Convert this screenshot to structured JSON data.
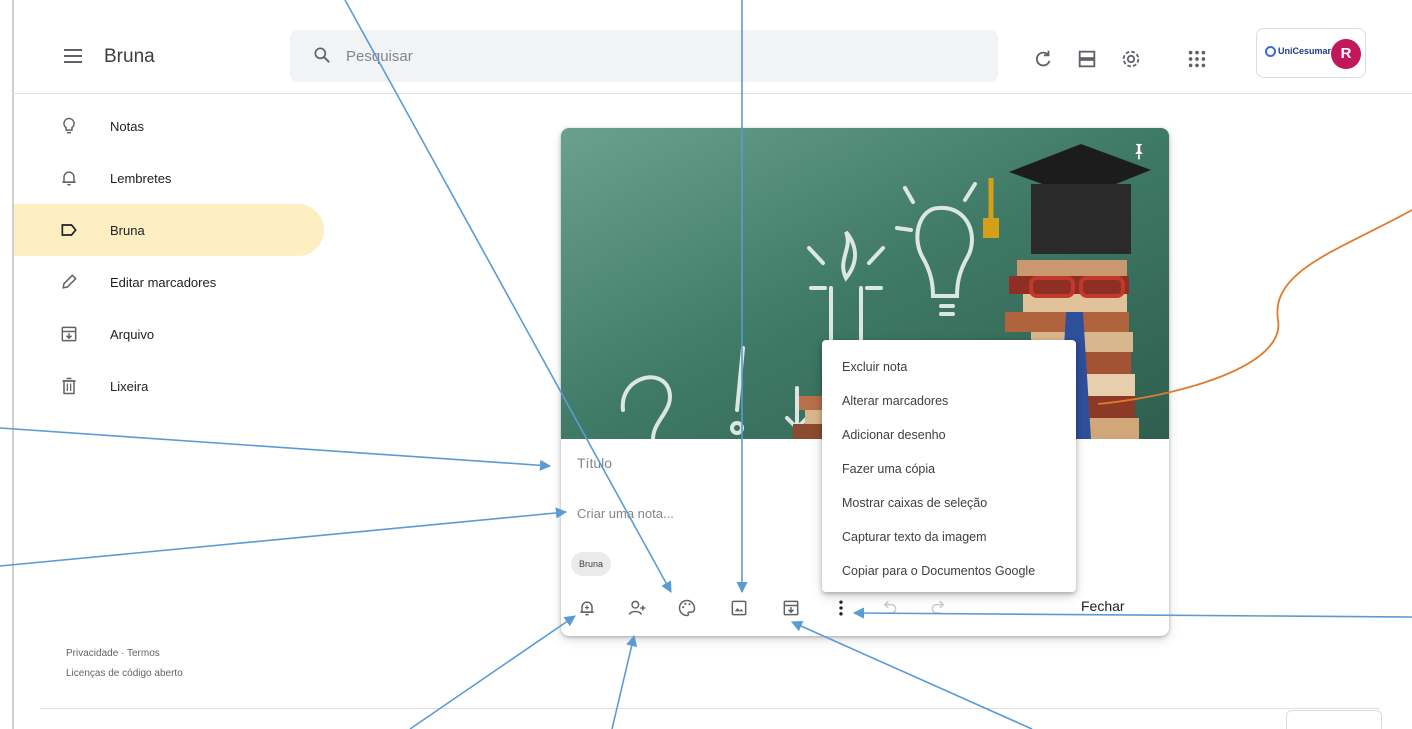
{
  "header": {
    "app_title": "Bruna",
    "search_placeholder": "Pesquisar",
    "org_logo_text": "UniCesumar",
    "avatar_initial": "R"
  },
  "sidebar": {
    "items": [
      {
        "label": "Notas",
        "icon": "lightbulb-icon"
      },
      {
        "label": "Lembretes",
        "icon": "bell-icon"
      },
      {
        "label": "Bruna",
        "icon": "label-icon",
        "active": true
      },
      {
        "label": "Editar marcadores",
        "icon": "pencil-icon"
      },
      {
        "label": "Arquivo",
        "icon": "archive-icon"
      },
      {
        "label": "Lixeira",
        "icon": "trash-icon"
      }
    ],
    "footer": {
      "privacy": "Privacidade",
      "separator": "·",
      "terms": "Termos",
      "licenses": "Licenças de código aberto"
    }
  },
  "note": {
    "title_placeholder": "Título",
    "body_placeholder": "Criar uma nota...",
    "label_chip": "Bruna",
    "close_label": "Fechar"
  },
  "context_menu": {
    "items": [
      "Excluir nota",
      "Alterar marcadores",
      "Adicionar desenho",
      "Fazer uma cópia",
      "Mostrar caixas de seleção",
      "Capturar texto da imagem",
      "Copiar para o Documentos Google"
    ]
  },
  "colors": {
    "active_label_bg": "#feefc3",
    "chalkboard": "#3f7a66",
    "annotation_arrow": "#5b9bd5",
    "annotation_curve": "#e07b2e",
    "avatar_bg": "#c2185b"
  }
}
